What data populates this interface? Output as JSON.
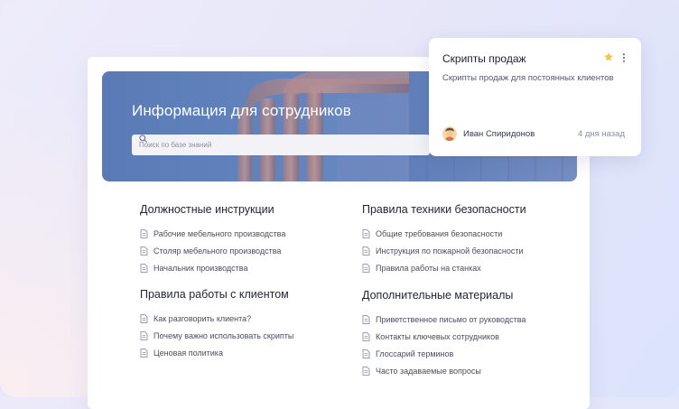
{
  "hero": {
    "title": "Информация для сотрудников",
    "search_placeholder": "Поиск по базе знаний"
  },
  "sections": [
    {
      "title": "Должностные инструкции",
      "items": [
        "Рабочие мебельного производства",
        "Столяр мебельного производства",
        "Начальник производства"
      ]
    },
    {
      "title": "Правила техники безопасности",
      "items": [
        "Общие требования безопасности",
        "Инструкция по пожарной безопасности",
        "Правила работы на станках"
      ]
    },
    {
      "title": "Правила работы с клиентом",
      "items": [
        "Как разговорить клиента?",
        "Почему важно использовать скрипты",
        "Ценовая политика"
      ]
    },
    {
      "title": "Дополнительные материалы",
      "items": [
        "Приветственное письмо от руководства",
        "Контакты ключевых сотрудников",
        "Глоссарий терминов",
        "Часто задаваемые вопросы"
      ]
    }
  ],
  "card": {
    "title": "Скрипты продаж",
    "description": "Скрипты продаж для постоянных клиентов",
    "author": "Иван Спиридонов",
    "date": "4 дня назад",
    "starred": true
  },
  "colors": {
    "accent_star": "#f6c343",
    "hero_blue": "#5a7bb6",
    "icon_gray": "#8e91aa"
  },
  "icons": [
    "search-icon",
    "document-icon",
    "star-icon",
    "more-vertical-icon",
    "avatar"
  ]
}
